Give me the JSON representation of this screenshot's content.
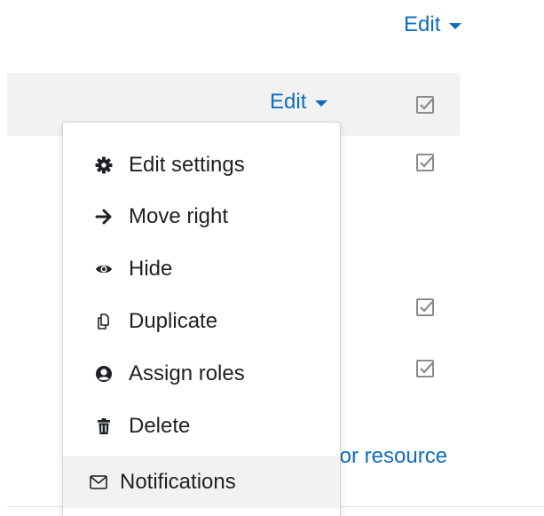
{
  "section": {
    "edit_label": "Edit"
  },
  "activity_row": {
    "edit_label": "Edit"
  },
  "menu": {
    "items": [
      {
        "label": "Edit settings",
        "icon": "gear-icon"
      },
      {
        "label": "Move right",
        "icon": "arrow-right-icon"
      },
      {
        "label": "Hide",
        "icon": "eye-icon"
      },
      {
        "label": "Duplicate",
        "icon": "copy-icon"
      },
      {
        "label": "Assign roles",
        "icon": "user-circle-icon"
      },
      {
        "label": "Delete",
        "icon": "trash-icon"
      },
      {
        "label": "Notifications",
        "icon": "envelope-icon"
      }
    ]
  },
  "add_activity_text": "y or resource",
  "colors": {
    "link": "#0f6cbf",
    "text": "#1d2125",
    "row_highlight": "#f2f2f2",
    "checkbox": "#8b8b8b"
  }
}
